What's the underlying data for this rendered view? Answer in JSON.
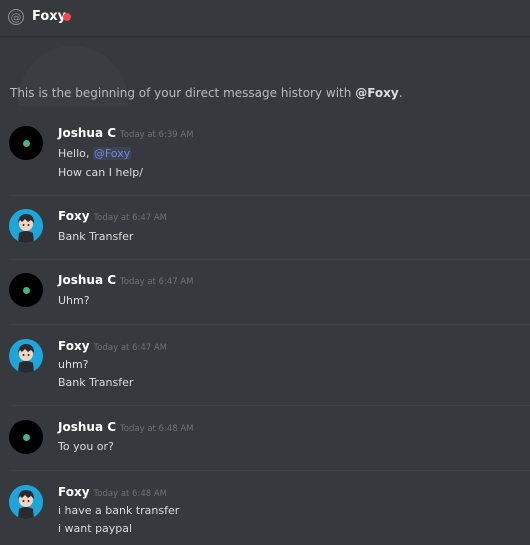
{
  "header": {
    "at_symbol": "@",
    "name": "Foxy",
    "status_color": "#f04747"
  },
  "beginning": {
    "prefix": "This is the beginning of your direct message history with ",
    "handle": "@Foxy",
    "suffix": "."
  },
  "messages": [
    {
      "author": "Joshua C",
      "timestamp": "Today at 6:39 AM",
      "avatar": "dark-avatar",
      "lines": [
        "Hello, ",
        "How can I help/"
      ],
      "mention": "@Foxy"
    },
    {
      "author": "Foxy",
      "timestamp": "Today at 6:47 AM",
      "avatar": "foxy-avatar",
      "lines": [
        "Bank Transfer"
      ]
    },
    {
      "author": "Joshua C",
      "timestamp": "Today at 6:47 AM",
      "avatar": "dark-avatar",
      "lines": [
        "Uhm?"
      ]
    },
    {
      "author": "Foxy",
      "timestamp": "Today at 6:47 AM",
      "avatar": "foxy-avatar",
      "lines": [
        "uhm?",
        "Bank Transfer"
      ]
    },
    {
      "author": "Joshua C",
      "timestamp": "Today at 6:48 AM",
      "avatar": "dark-avatar",
      "lines": [
        "To you or?"
      ]
    },
    {
      "author": "Foxy",
      "timestamp": "Today at 6:48 AM",
      "avatar": "foxy-avatar",
      "lines": [
        "i have a bank transfer",
        "i want paypal"
      ]
    }
  ]
}
